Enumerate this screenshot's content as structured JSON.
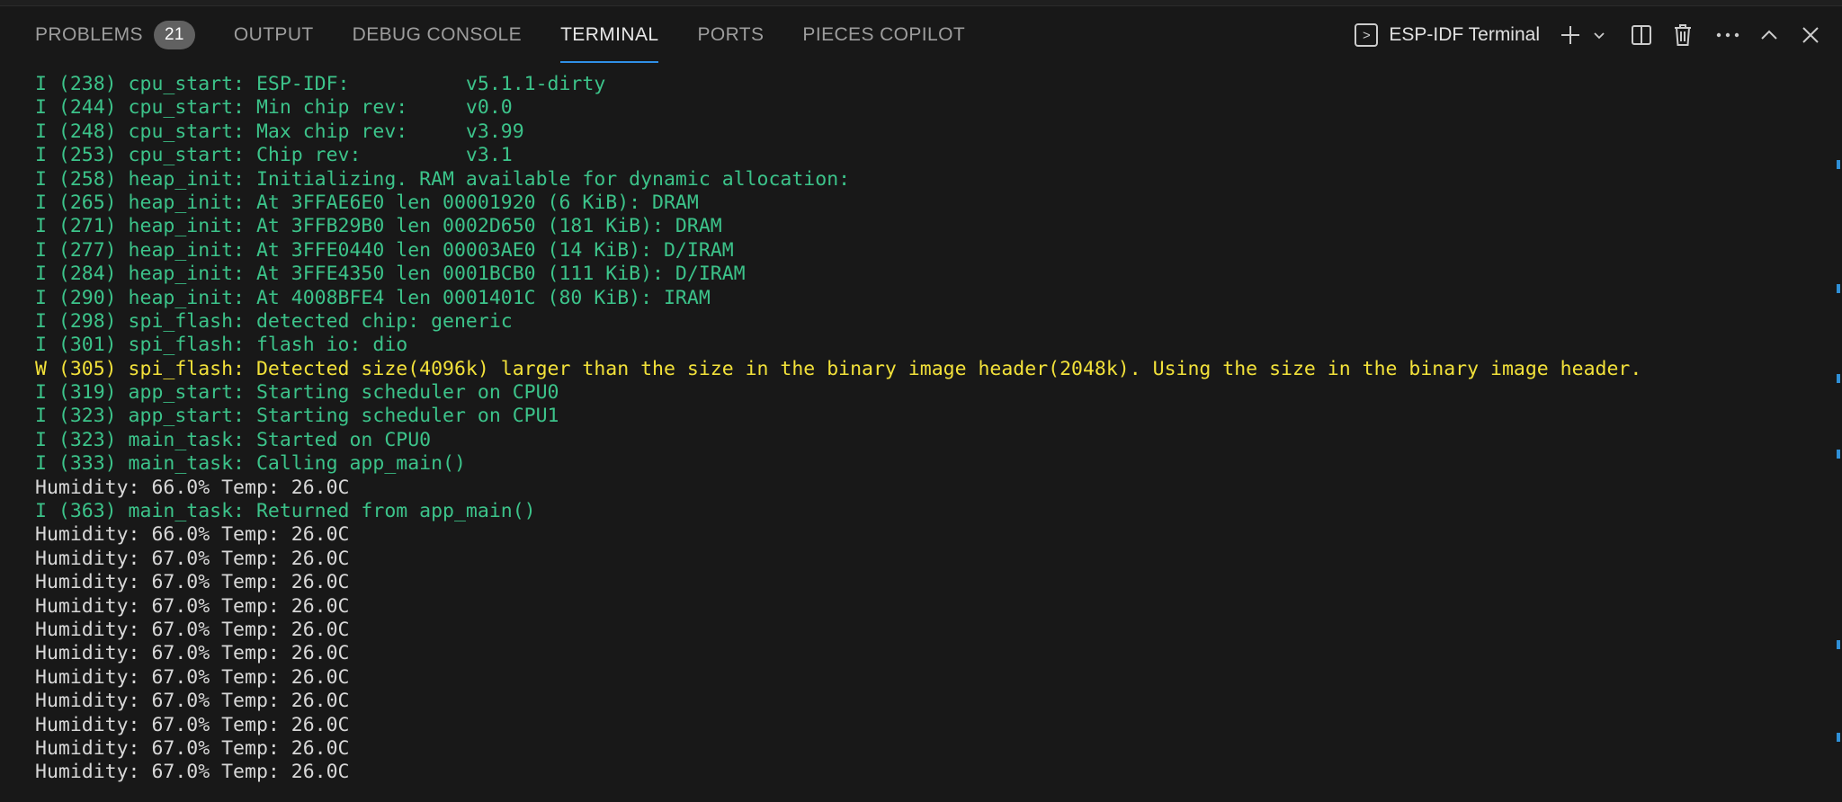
{
  "panel": {
    "tabs": [
      {
        "label": "PROBLEMS",
        "badge": "21"
      },
      {
        "label": "OUTPUT"
      },
      {
        "label": "DEBUG CONSOLE"
      },
      {
        "label": "TERMINAL"
      },
      {
        "label": "PORTS"
      },
      {
        "label": "PIECES COPILOT"
      }
    ],
    "active_tab": "TERMINAL",
    "terminal_name": "ESP-IDF Terminal",
    "icons": [
      "terminal-icon",
      "plus-icon",
      "chevron-down-icon",
      "split-icon",
      "trash-icon",
      "more-icon",
      "chevron-up-icon",
      "close-icon"
    ]
  },
  "colors": {
    "info": "#3cc38a",
    "warn": "#f2e13a",
    "plain": "#d8d8d8",
    "accent": "#2f8fe6",
    "background": "#181818"
  },
  "terminal_lines": [
    {
      "type": "info",
      "text": "I (238) cpu_start: ESP-IDF:          v5.1.1-dirty"
    },
    {
      "type": "info",
      "text": "I (244) cpu_start: Min chip rev:     v0.0"
    },
    {
      "type": "info",
      "text": "I (248) cpu_start: Max chip rev:     v3.99"
    },
    {
      "type": "info",
      "text": "I (253) cpu_start: Chip rev:         v3.1"
    },
    {
      "type": "info",
      "text": "I (258) heap_init: Initializing. RAM available for dynamic allocation:"
    },
    {
      "type": "info",
      "text": "I (265) heap_init: At 3FFAE6E0 len 00001920 (6 KiB): DRAM"
    },
    {
      "type": "info",
      "text": "I (271) heap_init: At 3FFB29B0 len 0002D650 (181 KiB): DRAM"
    },
    {
      "type": "info",
      "text": "I (277) heap_init: At 3FFE0440 len 00003AE0 (14 KiB): D/IRAM"
    },
    {
      "type": "info",
      "text": "I (284) heap_init: At 3FFE4350 len 0001BCB0 (111 KiB): D/IRAM"
    },
    {
      "type": "info",
      "text": "I (290) heap_init: At 4008BFE4 len 0001401C (80 KiB): IRAM"
    },
    {
      "type": "info",
      "text": "I (298) spi_flash: detected chip: generic"
    },
    {
      "type": "info",
      "text": "I (301) spi_flash: flash io: dio"
    },
    {
      "type": "warn",
      "text": "W (305) spi_flash: Detected size(4096k) larger than the size in the binary image header(2048k). Using the size in the binary image header."
    },
    {
      "type": "info",
      "text": "I (319) app_start: Starting scheduler on CPU0"
    },
    {
      "type": "info",
      "text": "I (323) app_start: Starting scheduler on CPU1"
    },
    {
      "type": "info",
      "text": "I (323) main_task: Started on CPU0"
    },
    {
      "type": "info",
      "text": "I (333) main_task: Calling app_main()"
    },
    {
      "type": "plain",
      "text": "Humidity: 66.0% Temp: 26.0C"
    },
    {
      "type": "info",
      "text": "I (363) main_task: Returned from app_main()"
    },
    {
      "type": "plain",
      "text": "Humidity: 66.0% Temp: 26.0C"
    },
    {
      "type": "plain",
      "text": "Humidity: 67.0% Temp: 26.0C"
    },
    {
      "type": "plain",
      "text": "Humidity: 67.0% Temp: 26.0C"
    },
    {
      "type": "plain",
      "text": "Humidity: 67.0% Temp: 26.0C"
    },
    {
      "type": "plain",
      "text": "Humidity: 67.0% Temp: 26.0C"
    },
    {
      "type": "plain",
      "text": "Humidity: 67.0% Temp: 26.0C"
    },
    {
      "type": "plain",
      "text": "Humidity: 67.0% Temp: 26.0C"
    },
    {
      "type": "plain",
      "text": "Humidity: 67.0% Temp: 26.0C"
    },
    {
      "type": "plain",
      "text": "Humidity: 67.0% Temp: 26.0C"
    },
    {
      "type": "plain",
      "text": "Humidity: 67.0% Temp: 26.0C"
    },
    {
      "type": "plain",
      "text": "Humidity: 67.0% Temp: 26.0C"
    }
  ]
}
